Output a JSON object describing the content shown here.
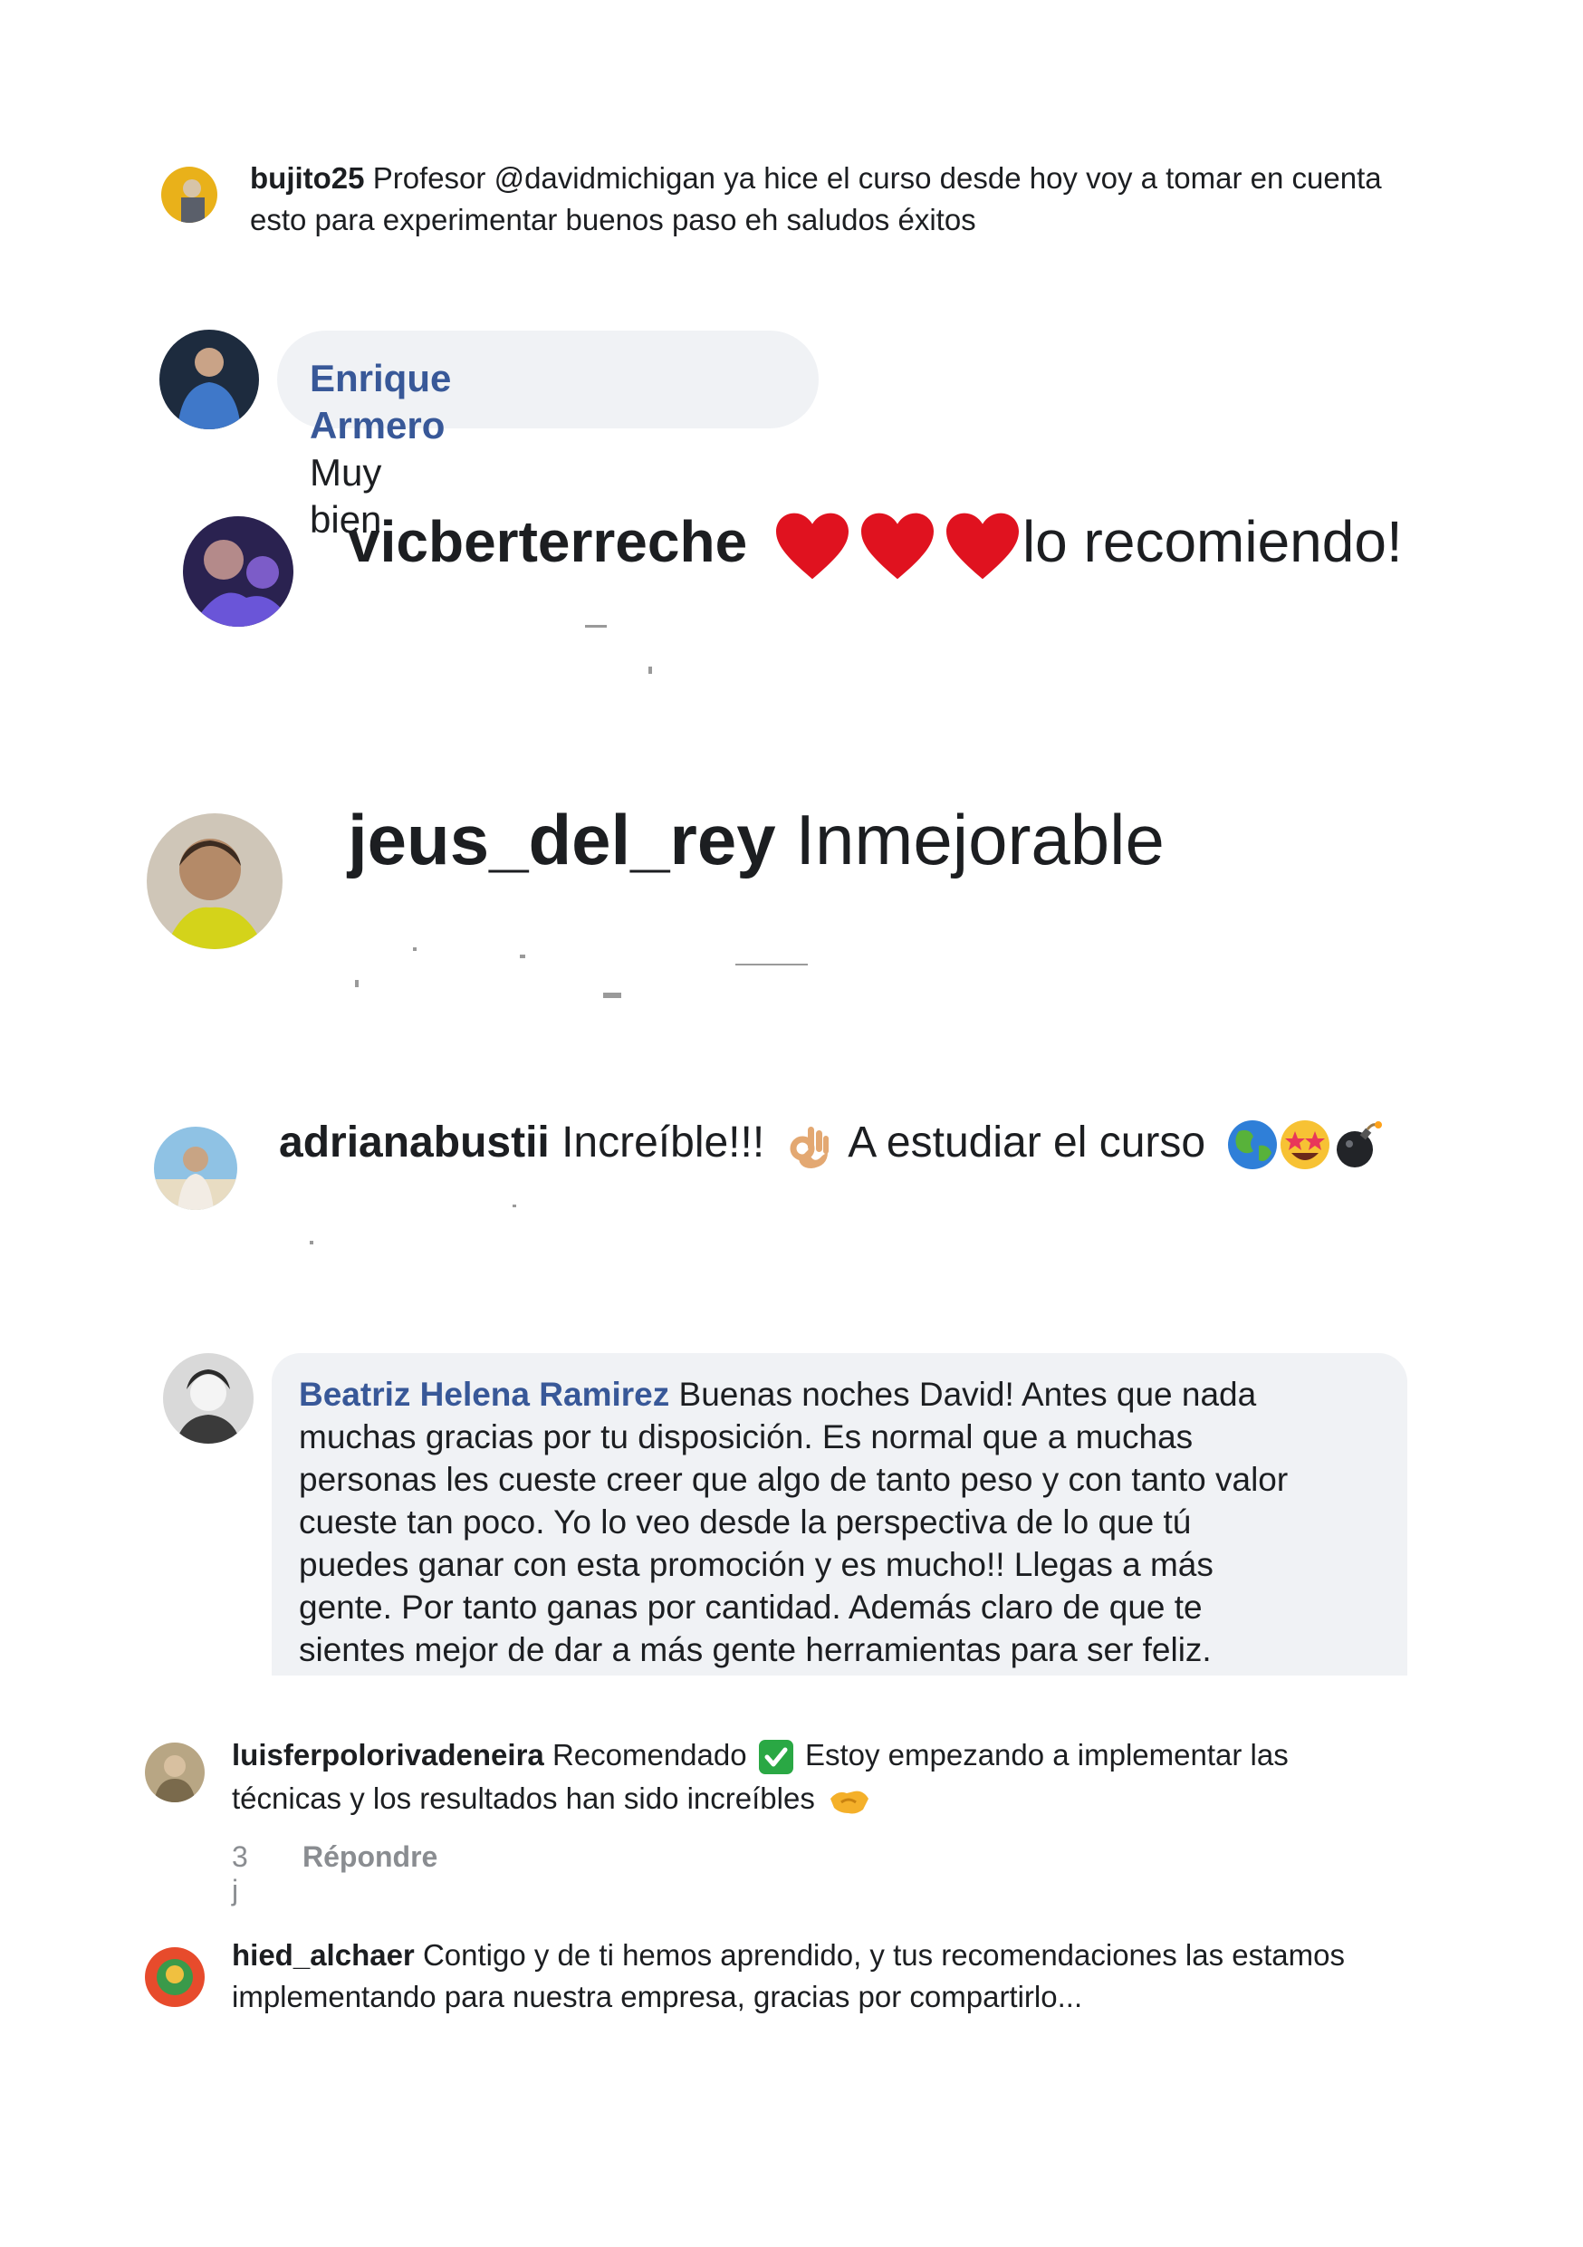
{
  "comments": [
    {
      "user": "bujito25",
      "text": "Profesor @davidmichigan ya hice el curso desde hoy voy a tomar en cuenta",
      "text2": "esto para experimentar buenos paso eh saludos éxitos"
    },
    {
      "user": "Enrique Armero",
      "text": "Muy bien"
    },
    {
      "user": "vicberterreche",
      "text": "lo recomiendo!",
      "emoji": "heart-icon"
    },
    {
      "user": "jeus_del_rey",
      "text": "Inmejorable"
    },
    {
      "user": "adrianabustii",
      "text": "Increíble!!!",
      "text2": "A estudiar el curso",
      "emojis": [
        "ok-hand-icon",
        "globe-icon",
        "star-struck-icon",
        "bomb-icon"
      ]
    },
    {
      "user": "Beatriz Helena Ramirez",
      "text": "Buenas noches David! Antes que nada",
      "lines": [
        "muchas gracias por tu disposición. Es normal que a muchas",
        "personas les cueste creer que algo de tanto peso y con tanto valor",
        "cueste tan poco. Yo lo veo desde la perspectiva de lo que tú",
        "puedes ganar con esta promoción y es mucho!! Llegas a más",
        "gente. Por tanto ganas por cantidad. Además claro de que te",
        "sientes mejor de dar a más gente herramientas para ser feliz."
      ]
    },
    {
      "user": "luisferpolorivadeneira",
      "text": "Recomendado",
      "text2": "Estoy empezando a implementar las",
      "text3": "técnicas y los resultados han sido increíbles",
      "time": "3 j",
      "reply": "Répondre",
      "emojis": [
        "check-mark-icon",
        "handshake-icon"
      ]
    },
    {
      "user": "hied_alchaer",
      "text": "Contigo y de ti hemos aprendido, y tus recomendaciones las estamos",
      "text2": "implementando para nuestra empresa, gracias por compartirlo..."
    }
  ],
  "colors": {
    "fb_name": "#385898",
    "bubble": "#f0f2f5",
    "heart": "#e0121f",
    "check": "#2aa844"
  }
}
